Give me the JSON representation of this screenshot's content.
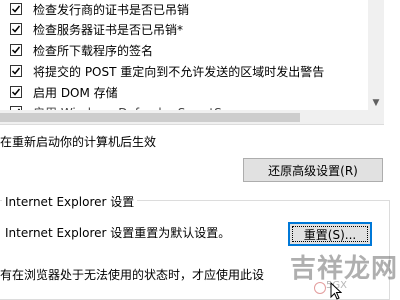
{
  "settings_list": {
    "items": [
      {
        "label": "检查发行商的证书是否已吊销",
        "checked": true
      },
      {
        "label": "检查服务器证书是否已吊销*",
        "checked": true
      },
      {
        "label": "检查所下载程序的签名",
        "checked": true
      },
      {
        "label": "将提交的 POST 重定向到不允许发送的区域时发出警告",
        "checked": true
      },
      {
        "label": "启用 DOM 存储",
        "checked": true
      },
      {
        "label": "启用 Windows Defender SmartScreen",
        "checked": true
      }
    ]
  },
  "restart_note": "在重新启动你的计算机后生效",
  "restore_button": {
    "label": "还原高级设置(R)"
  },
  "reset_group": {
    "title": "Internet Explorer 设置",
    "description": "Internet Explorer 设置重置为默认设置。",
    "reset_button_label": "重置(S)...",
    "note": "有在浏览器处于无法使用的状态时，才应使用此设"
  },
  "watermark": {
    "text": "吉祥龙网",
    "sub": "5GX"
  },
  "colors": {
    "focus_border": "#0078d7",
    "button_bg": "#e1e1e1",
    "scrollbar": "#f0f0f0"
  }
}
